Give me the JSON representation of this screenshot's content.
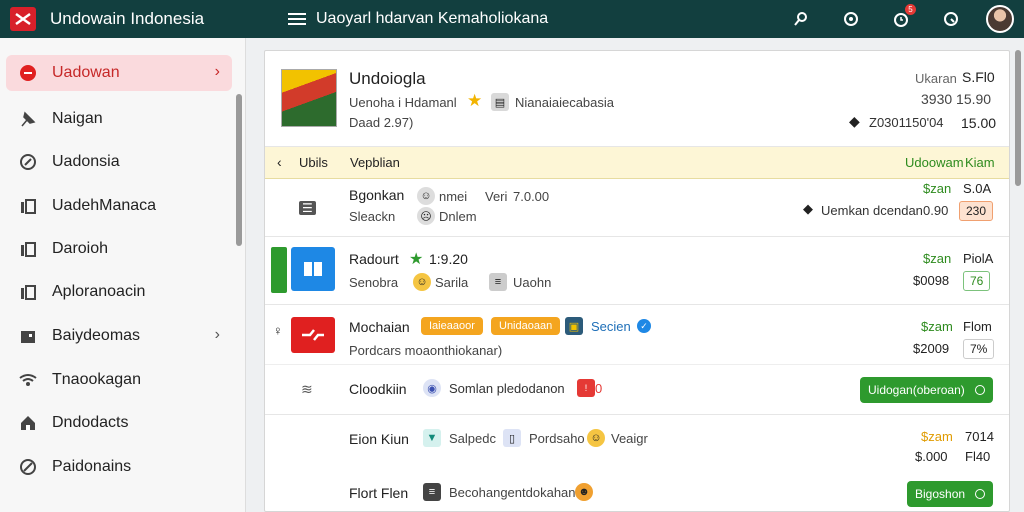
{
  "app": {
    "title": "Undowain Indonesia"
  },
  "header": {
    "page_title": "Uaoyarl hdarvan Kemaholiokana",
    "notif_count": "5"
  },
  "sidebar": {
    "items": [
      {
        "label": "Uadowan",
        "icon": "chat-icon"
      },
      {
        "label": "Naigan",
        "icon": "pin-icon"
      },
      {
        "label": "Uadonsia",
        "icon": "compass-icon"
      },
      {
        "label": "UadehManaca",
        "icon": "chart-icon"
      },
      {
        "label": "Daroioh",
        "icon": "document-icon"
      },
      {
        "label": "Aploranoacin",
        "icon": "bookmark-icon"
      },
      {
        "label": "Baiydeomas",
        "icon": "briefcase-icon"
      },
      {
        "label": "Tnaookagan",
        "icon": "wifi-icon"
      },
      {
        "label": "Dndodacts",
        "icon": "home-icon"
      },
      {
        "label": "Paidonains",
        "icon": "edit-icon"
      }
    ]
  },
  "product": {
    "title": "Undoiogla",
    "subtitle": "Uenoha i Hdamanl",
    "tag": "Nianaiaiecabasia",
    "meta": "Daad 2.97)",
    "right_label": "Ukaran",
    "right_value1": "S.Fl0",
    "right_line2": "3930   15.90",
    "right_line3": "Z0301150'04",
    "right_value3": "15.00"
  },
  "section": {
    "back": "Ubils",
    "title": "Vepblian",
    "right": "Udoowam",
    "right2": "Kiam"
  },
  "rows": [
    {
      "name": "Bgonkan",
      "tag1": "nmei",
      "tag2": "Veri",
      "tag2b": "7.0.00",
      "sub1": "Sleackn",
      "sub2": "Dnlem",
      "price": "$zan",
      "price2": "S.0A",
      "note": "Uemkan dcendan",
      "note_val": "0.90",
      "box": "230"
    },
    {
      "name": "Radourt",
      "rating": "1:9.20",
      "sub1": "Senobra",
      "sub2": "Sarila",
      "sub3": "Uaohn",
      "price": "$zan",
      "price2": "PiolA",
      "amount": "$0098",
      "box": "76"
    },
    {
      "name": "Mochaian",
      "chip1": "Iaieaaoor",
      "chip2": "Unidaoaan",
      "brand": "Secien",
      "sub": "Pordcars moaonthiokanar)",
      "price": "$zam",
      "price2": "Flom",
      "amount": "$2009",
      "box": "7%"
    },
    {
      "name": "Cloodkiin",
      "sub": "Somlan pledodanon",
      "count": "0",
      "button": "Uidogan(oberoan)"
    },
    {
      "name": "Eion Kiun",
      "sub1": "Salpedc",
      "sub2": "Pordsaho",
      "sub3": "Veaigr",
      "price": "$zam",
      "price2": "7014",
      "amount": "$.000",
      "box": "Fl40"
    },
    {
      "name": "Flort Flen",
      "sub": "Becohangentdokahan",
      "button": "Bigoshon"
    }
  ],
  "colors": {
    "topbar": "#123f3f",
    "accent": "#d8202a",
    "green": "#2e8b1e",
    "highlight": "#fdf6d6"
  }
}
